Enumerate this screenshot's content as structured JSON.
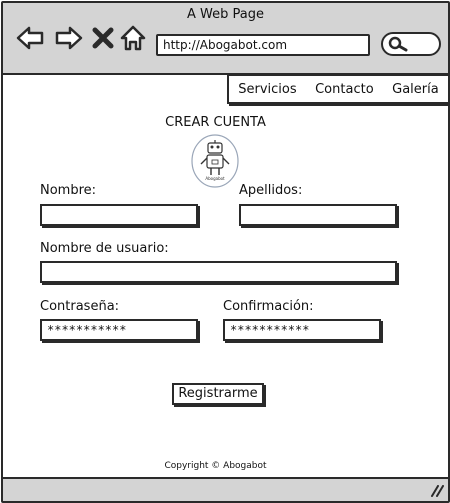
{
  "window": {
    "title": "A Web Page"
  },
  "browser": {
    "url": "http://Abogabot.com",
    "icons": [
      "back-arrow-icon",
      "forward-arrow-icon",
      "close-x-icon",
      "home-icon",
      "search-icon"
    ]
  },
  "nav": {
    "items": [
      "Servicios",
      "Contacto",
      "Galería"
    ]
  },
  "form": {
    "heading": "CREAR CUENTA",
    "logo_caption": "Abogabot",
    "nombre_label": "Nombre:",
    "nombre_value": "",
    "apellidos_label": "Apellidos:",
    "apellidos_value": "",
    "usuario_label": "Nombre de usuario:",
    "usuario_value": "",
    "password_label": "Contraseña:",
    "password_value": "***********",
    "confirm_label": "Confirmación:",
    "confirm_value": "***********",
    "submit_label": "Registrarme"
  },
  "footer": {
    "copyright": "Copyright © Abogabot"
  }
}
